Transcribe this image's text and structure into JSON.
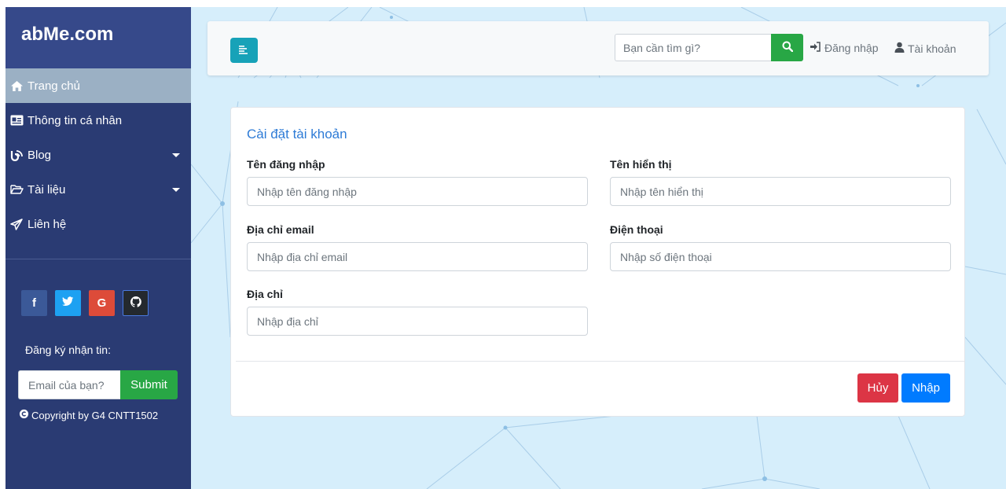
{
  "brand": "abMe.com",
  "sidebar": {
    "items": [
      {
        "label": "Trang chủ",
        "icon": "home-icon",
        "active": true
      },
      {
        "label": "Thông tin cá nhân",
        "icon": "id-card-icon"
      },
      {
        "label": "Blog",
        "icon": "blog-icon",
        "has_submenu": true
      },
      {
        "label": "Tài liệu",
        "icon": "folder-open-icon",
        "has_submenu": true
      },
      {
        "label": "Liên hệ",
        "icon": "paper-plane-icon"
      }
    ],
    "socials": [
      {
        "label": "f",
        "icon": "facebook-icon",
        "color": "#3b5998"
      },
      {
        "label": "t",
        "icon": "twitter-icon",
        "color": "#1da1f2"
      },
      {
        "label": "G",
        "icon": "google-icon",
        "color": "#dd4b39"
      },
      {
        "label": "gh",
        "icon": "github-icon",
        "color": "#24292e"
      }
    ],
    "newsletter_label": "Đăng ký nhận tin:",
    "newsletter_placeholder": "Email của bạn?",
    "newsletter_submit": "Submit",
    "copyright": "Copyright by G4 CNTT1502"
  },
  "topbar": {
    "search_placeholder": "Bạn cần tìm gì?",
    "login_label": "Đăng nhập",
    "account_label": "Tài khoản"
  },
  "form": {
    "title": "Cài đặt tài khoản",
    "username_label": "Tên đăng nhập",
    "username_placeholder": "Nhập tên đăng nhập",
    "display_name_label": "Tên hiển thị",
    "display_name_placeholder": "Nhập tên hiển thị",
    "email_label": "Địa chỉ email",
    "email_placeholder": "Nhập địa chỉ email",
    "phone_label": "Điện thoại",
    "phone_placeholder": "Nhập số điện thoại",
    "address_label": "Địa chỉ",
    "address_placeholder": "Nhập địa chỉ",
    "cancel_label": "Hủy",
    "submit_label": "Nhập"
  },
  "colors": {
    "sidebar_bg": "#2a3b73",
    "active_item": "#9bb0c4",
    "success": "#28a745",
    "info": "#17a2b8",
    "danger": "#dc3545",
    "primary": "#007bff",
    "title_blue": "#2e7bd6",
    "background": "#d6eefb"
  }
}
